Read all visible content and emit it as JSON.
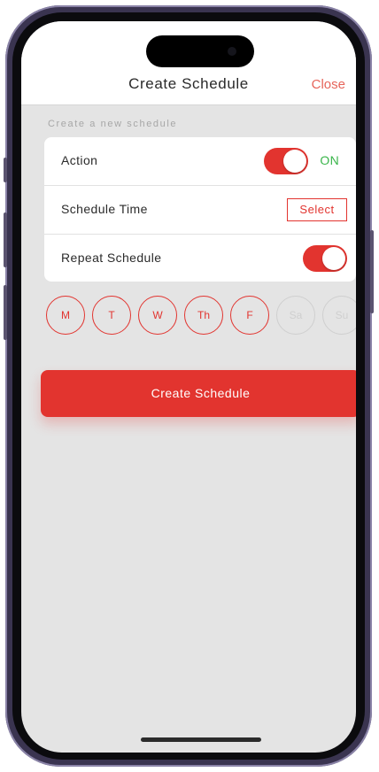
{
  "header": {
    "title": "Create Schedule",
    "close_label": "Close"
  },
  "section": {
    "label": "Create a new schedule"
  },
  "rows": {
    "action": {
      "label": "Action",
      "toggle_on": true,
      "state_text": "ON"
    },
    "schedule_time": {
      "label": "Schedule Time",
      "button_label": "Select"
    },
    "repeat": {
      "label": "Repeat Schedule",
      "toggle_on": true
    }
  },
  "days": [
    {
      "label": "M",
      "active": true
    },
    {
      "label": "T",
      "active": true
    },
    {
      "label": "W",
      "active": true
    },
    {
      "label": "Th",
      "active": true
    },
    {
      "label": "F",
      "active": true
    },
    {
      "label": "Sa",
      "active": false
    },
    {
      "label": "Su",
      "active": false
    }
  ],
  "create_button": {
    "label": "Create Schedule"
  },
  "colors": {
    "accent": "#e2342f",
    "on_text": "#39b54a",
    "close_text": "#e6645a",
    "screen_bg": "#e4e4e4"
  }
}
